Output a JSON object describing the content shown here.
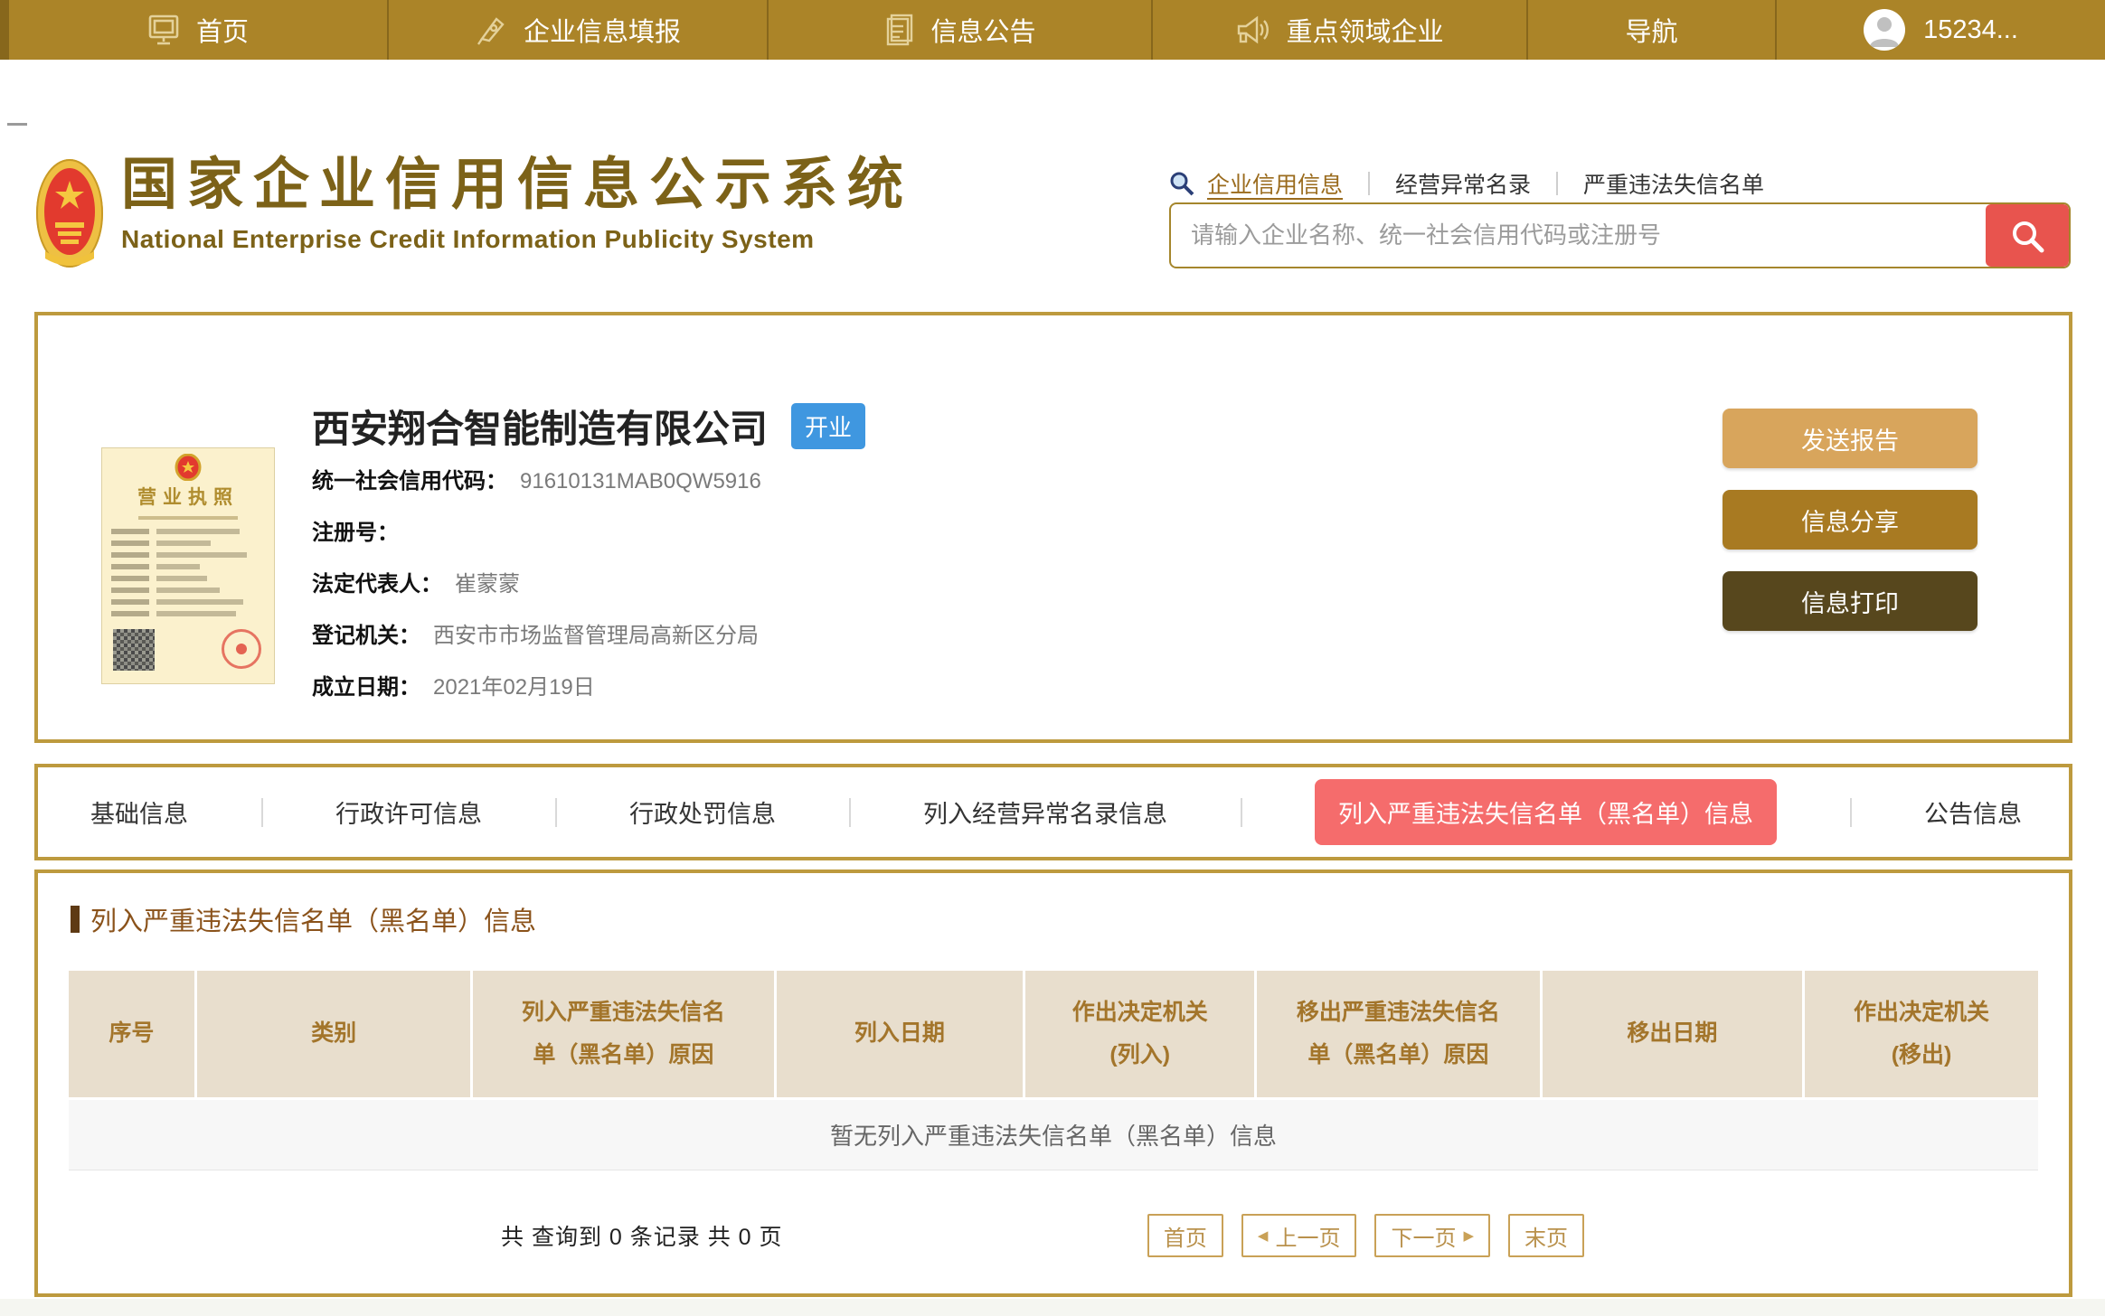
{
  "nav": {
    "items": [
      {
        "label": "首页",
        "icon": "monitor-icon"
      },
      {
        "label": "企业信息填报",
        "icon": "pen-icon"
      },
      {
        "label": "信息公告",
        "icon": "document-icon"
      },
      {
        "label": "重点领域企业",
        "icon": "megaphone-icon"
      },
      {
        "label": "导航",
        "icon": ""
      }
    ],
    "user": {
      "label": "15234...",
      "icon": "user-avatar-icon"
    }
  },
  "header": {
    "title": "国家企业信用信息公示系统",
    "subtitle": "National Enterprise Credit Information Publicity System",
    "search_tabs": [
      {
        "label": "企业信用信息",
        "active": true
      },
      {
        "label": "经营异常名录",
        "active": false
      },
      {
        "label": "严重违法失信名单",
        "active": false
      }
    ],
    "search": {
      "placeholder": "请输入企业名称、统一社会信用代码或注册号"
    }
  },
  "company": {
    "name": "西安翔合智能制造有限公司",
    "status_badge": "开业",
    "license_title": "营业执照",
    "fields": [
      {
        "label": "统一社会信用代码：",
        "value": "91610131MAB0QW5916"
      },
      {
        "label": "注册号：",
        "value": ""
      },
      {
        "label": "法定代表人：",
        "value": "崔蒙蒙"
      },
      {
        "label": "登记机关：",
        "value": "西安市市场监督管理局高新区分局"
      },
      {
        "label": "成立日期：",
        "value": "2021年02月19日"
      }
    ],
    "actions": [
      {
        "label": "发送报告"
      },
      {
        "label": "信息分享"
      },
      {
        "label": "信息打印"
      }
    ]
  },
  "tabs": [
    {
      "label": "基础信息",
      "active": false
    },
    {
      "label": "行政许可信息",
      "active": false
    },
    {
      "label": "行政处罚信息",
      "active": false
    },
    {
      "label": "列入经营异常名录信息",
      "active": false
    },
    {
      "label": "列入严重违法失信名单（黑名单）信息",
      "active": true
    },
    {
      "label": "公告信息",
      "active": false
    }
  ],
  "section": {
    "title": "列入严重违法失信名单（黑名单）信息",
    "table": {
      "headers": [
        "序号",
        "类别",
        "列入严重违法失信名\n单（黑名单）原因",
        "列入日期",
        "作出决定机关\n(列入)",
        "移出严重违法失信名\n单（黑名单）原因",
        "移出日期",
        "作出决定机关\n(移出)"
      ],
      "empty_text": "暂无列入严重违法失信名单（黑名单）信息"
    },
    "pagination": {
      "summary": "共 查询到 0 条记录 共 0 页",
      "first": "首页",
      "prev": "上一页",
      "next": "下一页",
      "last": "末页",
      "prev_arrow": "◀",
      "next_arrow": "▶"
    }
  },
  "colors": {
    "nav_gold": "#ab8428",
    "brand_brown": "#7c6218",
    "card_border_gold": "#bd9a3e",
    "search_button_red": "#e8544e",
    "active_tab_red": "#f56c6c",
    "status_badge_blue": "#3f97e0",
    "table_header_bg": "#e8decd",
    "table_header_text": "#a3752b",
    "action_send": "#d8a55c",
    "action_share": "#a87a22",
    "action_print": "#57471d"
  }
}
